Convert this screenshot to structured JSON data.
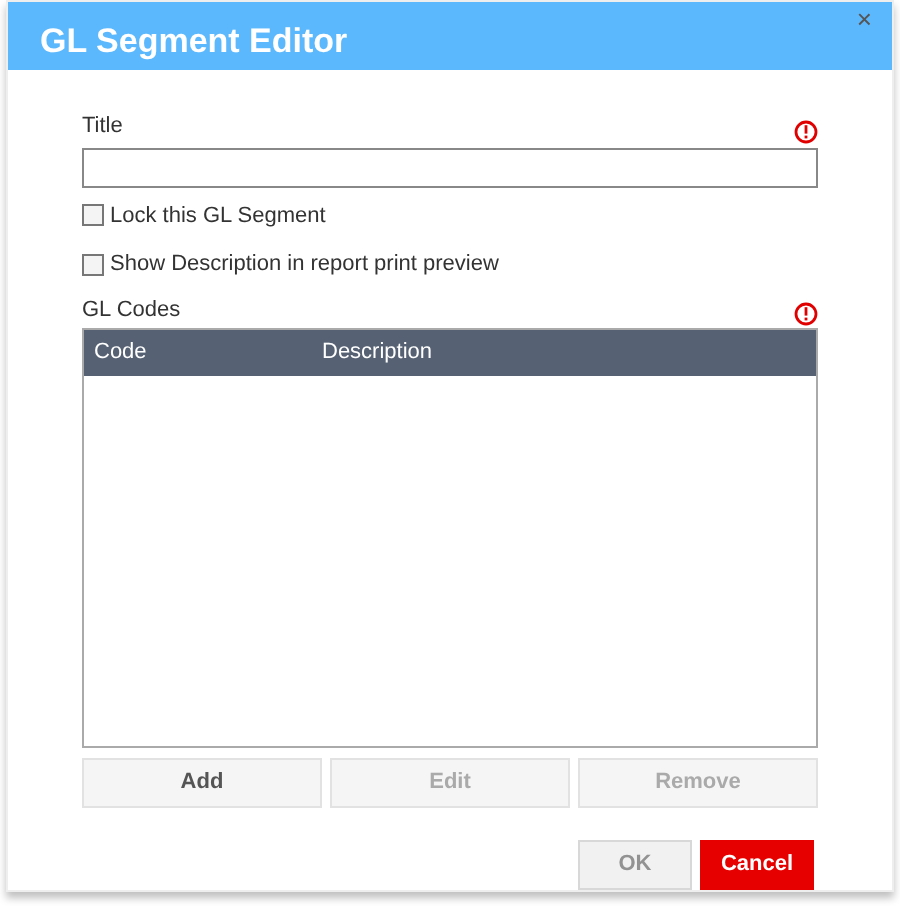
{
  "dialog": {
    "title": "GL Segment Editor",
    "close": "×"
  },
  "title_field": {
    "label": "Title",
    "required": true
  },
  "checkboxes": [
    {
      "label": "Lock this GL Segment",
      "checked": false
    },
    {
      "label": "Show Description in report print preview",
      "checked": false
    }
  ],
  "gl_codes": {
    "label": "GL Codes",
    "required": true,
    "columns": [
      "Code",
      "Description"
    ]
  },
  "table_buttons": [
    {
      "label": "Add",
      "disabled": false
    },
    {
      "label": "Edit",
      "disabled": true
    },
    {
      "label": "Remove",
      "disabled": true
    }
  ],
  "footer_buttons": [
    {
      "label": "OK",
      "kind": "secondary",
      "disabled": true
    },
    {
      "label": "Cancel",
      "kind": "danger",
      "disabled": false
    }
  ]
}
